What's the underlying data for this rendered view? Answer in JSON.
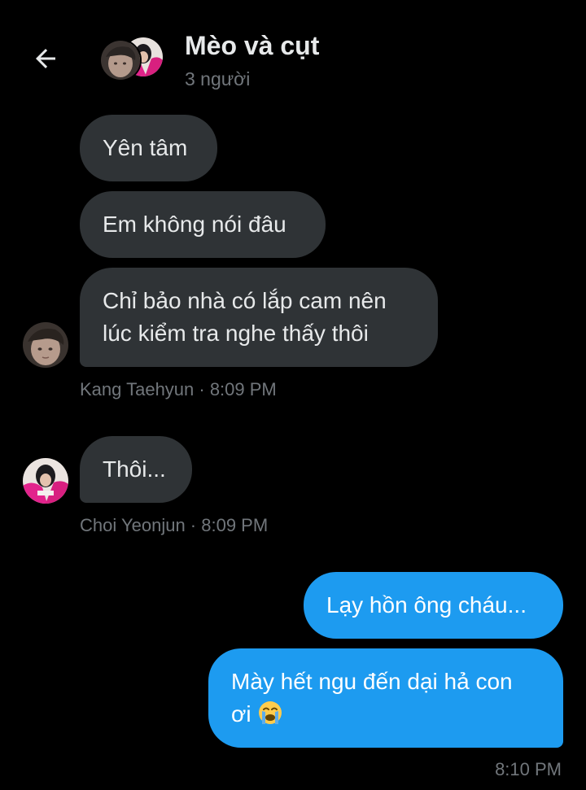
{
  "header": {
    "title": "Mèo và cụt",
    "subtitle": "3 người",
    "back_icon": "arrow-left-icon"
  },
  "messages": [
    {
      "text": "Yên tâm"
    },
    {
      "text": "Em không nói đâu"
    },
    {
      "line1": "Chỉ bảo nhà có lắp cam nên",
      "line2": "lúc kiểm tra nghe thấy thôi"
    },
    {
      "text": "Thôi..."
    },
    {
      "text": "Lạy hồn ông cháu..."
    },
    {
      "line1": "Mày hết ngu đến dại hả con",
      "line2": "ơi",
      "emoji": "loudly-crying-face"
    }
  ],
  "meta": {
    "kang": "Kang Taehyun · 8:09 PM",
    "choi": "Choi Yeonjun · 8:09 PM",
    "sent": "8:10 PM"
  },
  "colors": {
    "background": "#000000",
    "incoming_bubble": "#2f3336",
    "outgoing_bubble": "#1d9bf0",
    "secondary_text": "#71767b",
    "primary_text": "#e7e9ea"
  }
}
